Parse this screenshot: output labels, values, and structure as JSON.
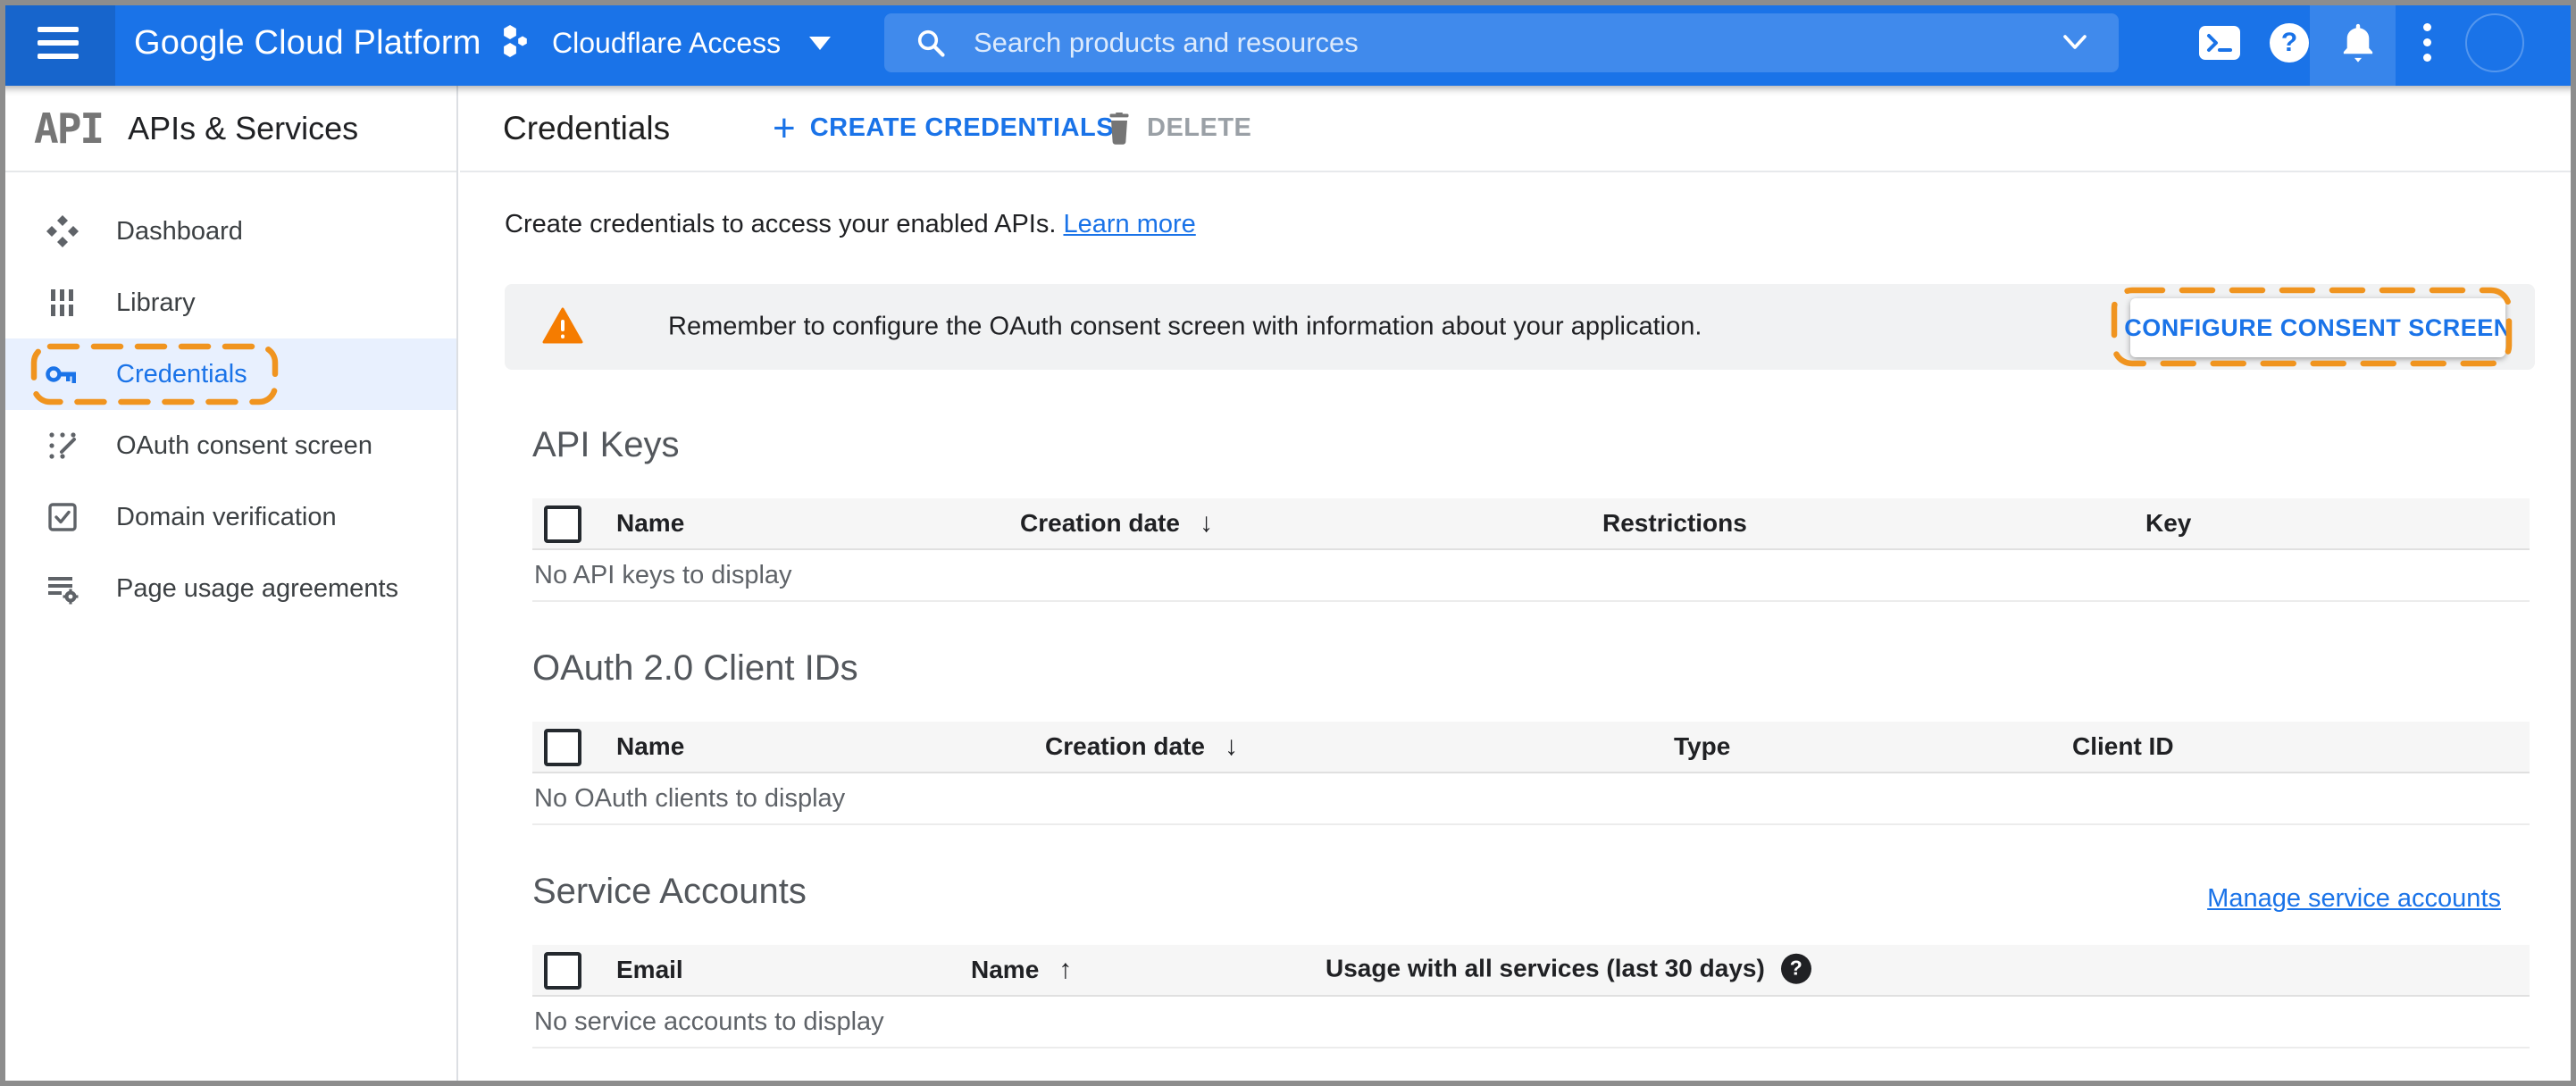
{
  "colors": {
    "topbar_blue": "#1a73e8",
    "accent_blue": "#1a73e8",
    "annotation_orange": "#f0941f",
    "warning_orange": "#f57c00",
    "selected_item_bg": "#e8f0fe",
    "table_header_bg": "#f6f6f6"
  },
  "header": {
    "brand": "Google Cloud Platform",
    "project_name": "Cloudflare Access",
    "search_placeholder": "Search products and resources"
  },
  "sidebar": {
    "logo": "API",
    "title": "APIs & Services",
    "items": [
      {
        "label": "Dashboard",
        "icon": "dashboard-icon",
        "active": false
      },
      {
        "label": "Library",
        "icon": "library-icon",
        "active": false
      },
      {
        "label": "Credentials",
        "icon": "key-icon",
        "active": true,
        "annotated": true
      },
      {
        "label": "OAuth consent screen",
        "icon": "oauth-consent-icon",
        "active": false
      },
      {
        "label": "Domain verification",
        "icon": "domain-verification-icon",
        "active": false
      },
      {
        "label": "Page usage agreements",
        "icon": "page-usage-icon",
        "active": false
      }
    ]
  },
  "toolbar": {
    "title": "Credentials",
    "create_label": "CREATE CREDENTIALS",
    "delete_label": "DELETE"
  },
  "intro": {
    "text": "Create credentials to access your enabled APIs.",
    "link_label": "Learn more"
  },
  "banner": {
    "message": "Remember to configure the OAuth consent screen with information about your application.",
    "button_label": "CONFIGURE CONSENT SCREEN"
  },
  "sections": {
    "api_keys": {
      "title": "API Keys",
      "columns": [
        "Name",
        "Creation date",
        "Restrictions",
        "Key"
      ],
      "sort_arrow": "↓",
      "empty": "No API keys to display"
    },
    "oauth_clients": {
      "title": "OAuth 2.0 Client IDs",
      "columns": [
        "Name",
        "Creation date",
        "Type",
        "Client ID"
      ],
      "sort_arrow": "↓",
      "empty": "No OAuth clients to display"
    },
    "service_accounts": {
      "title": "Service Accounts",
      "link_label": "Manage service accounts",
      "columns": [
        "Email",
        "Name",
        "Usage with all services (last 30 days)"
      ],
      "sort_arrow": "↑",
      "help_glyph": "?",
      "empty": "No service accounts to display"
    }
  },
  "glyphs": {
    "plus": "+",
    "question_mark": "?"
  }
}
